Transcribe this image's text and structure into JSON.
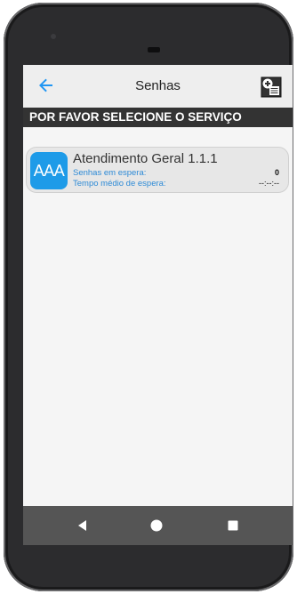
{
  "appbar": {
    "title": "Senhas",
    "back_icon": "arrow-left-icon",
    "action_icon": "add-ticket-icon",
    "accent_color": "#2196f3"
  },
  "banner": {
    "text": "POR FAVOR SELECIONE O SERVIÇO"
  },
  "services": [
    {
      "avatar": "AAA",
      "name": "Atendimento Geral 1.1.1",
      "waiting_label": "Senhas em espera:",
      "waiting_value": "0",
      "avg_label": "Tempo médio de espera:",
      "avg_value": "--:--:--",
      "avatar_color": "#1e9be8"
    }
  ],
  "navbar": {
    "back_icon": "triangle-back-icon",
    "home_icon": "circle-home-icon",
    "recents_icon": "square-recents-icon"
  }
}
